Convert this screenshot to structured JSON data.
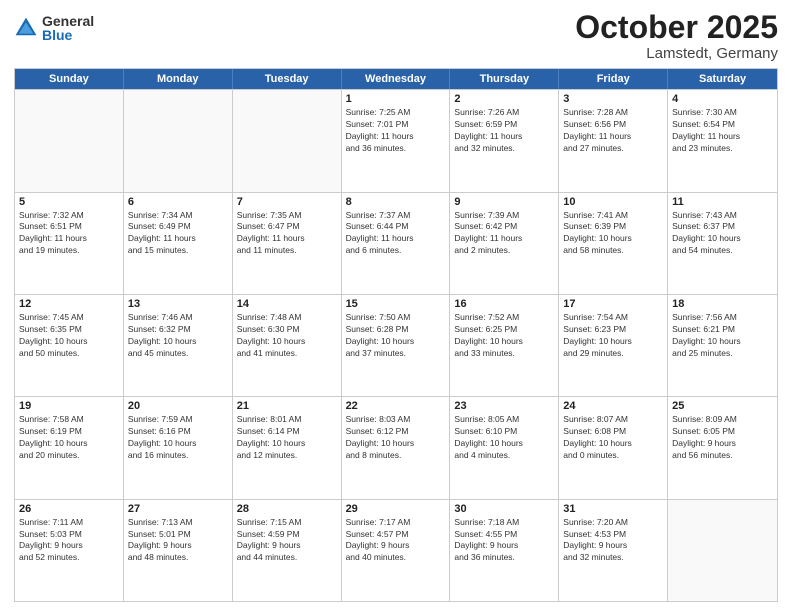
{
  "logo": {
    "general": "General",
    "blue": "Blue"
  },
  "title": "October 2025",
  "location": "Lamstedt, Germany",
  "weekdays": [
    "Sunday",
    "Monday",
    "Tuesday",
    "Wednesday",
    "Thursday",
    "Friday",
    "Saturday"
  ],
  "rows": [
    [
      {
        "day": "",
        "info": ""
      },
      {
        "day": "",
        "info": ""
      },
      {
        "day": "",
        "info": ""
      },
      {
        "day": "1",
        "info": "Sunrise: 7:25 AM\nSunset: 7:01 PM\nDaylight: 11 hours\nand 36 minutes."
      },
      {
        "day": "2",
        "info": "Sunrise: 7:26 AM\nSunset: 6:59 PM\nDaylight: 11 hours\nand 32 minutes."
      },
      {
        "day": "3",
        "info": "Sunrise: 7:28 AM\nSunset: 6:56 PM\nDaylight: 11 hours\nand 27 minutes."
      },
      {
        "day": "4",
        "info": "Sunrise: 7:30 AM\nSunset: 6:54 PM\nDaylight: 11 hours\nand 23 minutes."
      }
    ],
    [
      {
        "day": "5",
        "info": "Sunrise: 7:32 AM\nSunset: 6:51 PM\nDaylight: 11 hours\nand 19 minutes."
      },
      {
        "day": "6",
        "info": "Sunrise: 7:34 AM\nSunset: 6:49 PM\nDaylight: 11 hours\nand 15 minutes."
      },
      {
        "day": "7",
        "info": "Sunrise: 7:35 AM\nSunset: 6:47 PM\nDaylight: 11 hours\nand 11 minutes."
      },
      {
        "day": "8",
        "info": "Sunrise: 7:37 AM\nSunset: 6:44 PM\nDaylight: 11 hours\nand 6 minutes."
      },
      {
        "day": "9",
        "info": "Sunrise: 7:39 AM\nSunset: 6:42 PM\nDaylight: 11 hours\nand 2 minutes."
      },
      {
        "day": "10",
        "info": "Sunrise: 7:41 AM\nSunset: 6:39 PM\nDaylight: 10 hours\nand 58 minutes."
      },
      {
        "day": "11",
        "info": "Sunrise: 7:43 AM\nSunset: 6:37 PM\nDaylight: 10 hours\nand 54 minutes."
      }
    ],
    [
      {
        "day": "12",
        "info": "Sunrise: 7:45 AM\nSunset: 6:35 PM\nDaylight: 10 hours\nand 50 minutes."
      },
      {
        "day": "13",
        "info": "Sunrise: 7:46 AM\nSunset: 6:32 PM\nDaylight: 10 hours\nand 45 minutes."
      },
      {
        "day": "14",
        "info": "Sunrise: 7:48 AM\nSunset: 6:30 PM\nDaylight: 10 hours\nand 41 minutes."
      },
      {
        "day": "15",
        "info": "Sunrise: 7:50 AM\nSunset: 6:28 PM\nDaylight: 10 hours\nand 37 minutes."
      },
      {
        "day": "16",
        "info": "Sunrise: 7:52 AM\nSunset: 6:25 PM\nDaylight: 10 hours\nand 33 minutes."
      },
      {
        "day": "17",
        "info": "Sunrise: 7:54 AM\nSunset: 6:23 PM\nDaylight: 10 hours\nand 29 minutes."
      },
      {
        "day": "18",
        "info": "Sunrise: 7:56 AM\nSunset: 6:21 PM\nDaylight: 10 hours\nand 25 minutes."
      }
    ],
    [
      {
        "day": "19",
        "info": "Sunrise: 7:58 AM\nSunset: 6:19 PM\nDaylight: 10 hours\nand 20 minutes."
      },
      {
        "day": "20",
        "info": "Sunrise: 7:59 AM\nSunset: 6:16 PM\nDaylight: 10 hours\nand 16 minutes."
      },
      {
        "day": "21",
        "info": "Sunrise: 8:01 AM\nSunset: 6:14 PM\nDaylight: 10 hours\nand 12 minutes."
      },
      {
        "day": "22",
        "info": "Sunrise: 8:03 AM\nSunset: 6:12 PM\nDaylight: 10 hours\nand 8 minutes."
      },
      {
        "day": "23",
        "info": "Sunrise: 8:05 AM\nSunset: 6:10 PM\nDaylight: 10 hours\nand 4 minutes."
      },
      {
        "day": "24",
        "info": "Sunrise: 8:07 AM\nSunset: 6:08 PM\nDaylight: 10 hours\nand 0 minutes."
      },
      {
        "day": "25",
        "info": "Sunrise: 8:09 AM\nSunset: 6:05 PM\nDaylight: 9 hours\nand 56 minutes."
      }
    ],
    [
      {
        "day": "26",
        "info": "Sunrise: 7:11 AM\nSunset: 5:03 PM\nDaylight: 9 hours\nand 52 minutes."
      },
      {
        "day": "27",
        "info": "Sunrise: 7:13 AM\nSunset: 5:01 PM\nDaylight: 9 hours\nand 48 minutes."
      },
      {
        "day": "28",
        "info": "Sunrise: 7:15 AM\nSunset: 4:59 PM\nDaylight: 9 hours\nand 44 minutes."
      },
      {
        "day": "29",
        "info": "Sunrise: 7:17 AM\nSunset: 4:57 PM\nDaylight: 9 hours\nand 40 minutes."
      },
      {
        "day": "30",
        "info": "Sunrise: 7:18 AM\nSunset: 4:55 PM\nDaylight: 9 hours\nand 36 minutes."
      },
      {
        "day": "31",
        "info": "Sunrise: 7:20 AM\nSunset: 4:53 PM\nDaylight: 9 hours\nand 32 minutes."
      },
      {
        "day": "",
        "info": ""
      }
    ]
  ]
}
